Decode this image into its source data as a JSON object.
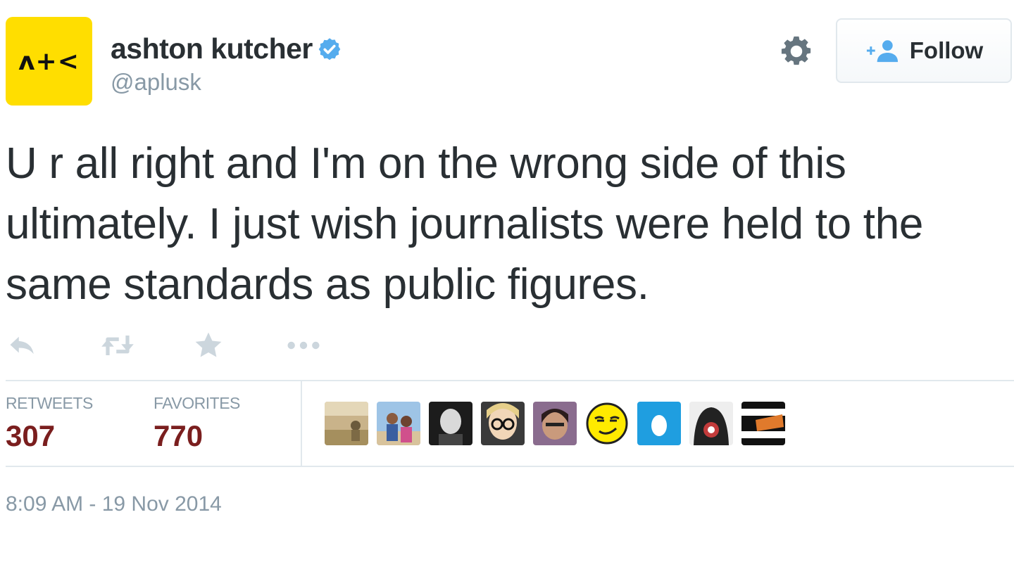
{
  "author": {
    "avatar_text": "ʌ+<",
    "avatar_color": "#ffde00",
    "name": "ashton kutcher",
    "handle": "@aplusk",
    "verified_icon": "verified-badge-icon"
  },
  "header": {
    "settings_icon": "gear-icon",
    "follow_label": "Follow",
    "follow_icon": "add-user-icon"
  },
  "tweet": {
    "text": "U r all right and I'm on the wrong side of this ultimately. I just wish journalists were held to the same standards as public figures."
  },
  "actions": [
    {
      "name": "reply",
      "icon": "reply-icon"
    },
    {
      "name": "retweet",
      "icon": "retweet-icon"
    },
    {
      "name": "favorite",
      "icon": "star-icon"
    },
    {
      "name": "more",
      "icon": "more-icon"
    }
  ],
  "stats": {
    "retweets_label": "RETWEETS",
    "retweets_value": "307",
    "favorites_label": "FAVORITES",
    "favorites_value": "770"
  },
  "favoriters": [
    {
      "icon": "user-avatar-photo"
    },
    {
      "icon": "user-avatar-photo"
    },
    {
      "icon": "user-avatar-photo"
    },
    {
      "icon": "user-avatar-photo"
    },
    {
      "icon": "user-avatar-photo"
    },
    {
      "icon": "smiley-face-avatar"
    },
    {
      "icon": "egg-avatar"
    },
    {
      "icon": "user-avatar-photo"
    },
    {
      "icon": "user-avatar-photo"
    }
  ],
  "timestamp": "8:09 AM - 19 Nov 2014",
  "colors": {
    "stat_value": "#7a1e1e",
    "muted": "#8899a6",
    "verified": "#55acee",
    "text": "#292f33"
  }
}
